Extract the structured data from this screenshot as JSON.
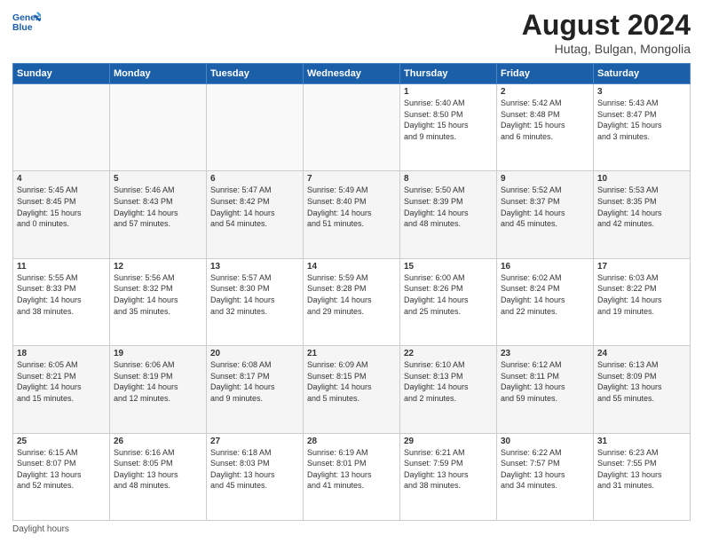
{
  "logo": {
    "text_general": "General",
    "text_blue": "Blue"
  },
  "header": {
    "month_year": "August 2024",
    "location": "Hutag, Bulgan, Mongolia"
  },
  "days_of_week": [
    "Sunday",
    "Monday",
    "Tuesday",
    "Wednesday",
    "Thursday",
    "Friday",
    "Saturday"
  ],
  "footer": {
    "daylight_label": "Daylight hours"
  },
  "weeks": [
    {
      "days": [
        {
          "num": "",
          "info": "",
          "empty": true
        },
        {
          "num": "",
          "info": "",
          "empty": true
        },
        {
          "num": "",
          "info": "",
          "empty": true
        },
        {
          "num": "",
          "info": "",
          "empty": true
        },
        {
          "num": "1",
          "info": "Sunrise: 5:40 AM\nSunset: 8:50 PM\nDaylight: 15 hours\nand 9 minutes."
        },
        {
          "num": "2",
          "info": "Sunrise: 5:42 AM\nSunset: 8:48 PM\nDaylight: 15 hours\nand 6 minutes."
        },
        {
          "num": "3",
          "info": "Sunrise: 5:43 AM\nSunset: 8:47 PM\nDaylight: 15 hours\nand 3 minutes."
        }
      ]
    },
    {
      "days": [
        {
          "num": "4",
          "info": "Sunrise: 5:45 AM\nSunset: 8:45 PM\nDaylight: 15 hours\nand 0 minutes."
        },
        {
          "num": "5",
          "info": "Sunrise: 5:46 AM\nSunset: 8:43 PM\nDaylight: 14 hours\nand 57 minutes."
        },
        {
          "num": "6",
          "info": "Sunrise: 5:47 AM\nSunset: 8:42 PM\nDaylight: 14 hours\nand 54 minutes."
        },
        {
          "num": "7",
          "info": "Sunrise: 5:49 AM\nSunset: 8:40 PM\nDaylight: 14 hours\nand 51 minutes."
        },
        {
          "num": "8",
          "info": "Sunrise: 5:50 AM\nSunset: 8:39 PM\nDaylight: 14 hours\nand 48 minutes."
        },
        {
          "num": "9",
          "info": "Sunrise: 5:52 AM\nSunset: 8:37 PM\nDaylight: 14 hours\nand 45 minutes."
        },
        {
          "num": "10",
          "info": "Sunrise: 5:53 AM\nSunset: 8:35 PM\nDaylight: 14 hours\nand 42 minutes."
        }
      ]
    },
    {
      "days": [
        {
          "num": "11",
          "info": "Sunrise: 5:55 AM\nSunset: 8:33 PM\nDaylight: 14 hours\nand 38 minutes."
        },
        {
          "num": "12",
          "info": "Sunrise: 5:56 AM\nSunset: 8:32 PM\nDaylight: 14 hours\nand 35 minutes."
        },
        {
          "num": "13",
          "info": "Sunrise: 5:57 AM\nSunset: 8:30 PM\nDaylight: 14 hours\nand 32 minutes."
        },
        {
          "num": "14",
          "info": "Sunrise: 5:59 AM\nSunset: 8:28 PM\nDaylight: 14 hours\nand 29 minutes."
        },
        {
          "num": "15",
          "info": "Sunrise: 6:00 AM\nSunset: 8:26 PM\nDaylight: 14 hours\nand 25 minutes."
        },
        {
          "num": "16",
          "info": "Sunrise: 6:02 AM\nSunset: 8:24 PM\nDaylight: 14 hours\nand 22 minutes."
        },
        {
          "num": "17",
          "info": "Sunrise: 6:03 AM\nSunset: 8:22 PM\nDaylight: 14 hours\nand 19 minutes."
        }
      ]
    },
    {
      "days": [
        {
          "num": "18",
          "info": "Sunrise: 6:05 AM\nSunset: 8:21 PM\nDaylight: 14 hours\nand 15 minutes."
        },
        {
          "num": "19",
          "info": "Sunrise: 6:06 AM\nSunset: 8:19 PM\nDaylight: 14 hours\nand 12 minutes."
        },
        {
          "num": "20",
          "info": "Sunrise: 6:08 AM\nSunset: 8:17 PM\nDaylight: 14 hours\nand 9 minutes."
        },
        {
          "num": "21",
          "info": "Sunrise: 6:09 AM\nSunset: 8:15 PM\nDaylight: 14 hours\nand 5 minutes."
        },
        {
          "num": "22",
          "info": "Sunrise: 6:10 AM\nSunset: 8:13 PM\nDaylight: 14 hours\nand 2 minutes."
        },
        {
          "num": "23",
          "info": "Sunrise: 6:12 AM\nSunset: 8:11 PM\nDaylight: 13 hours\nand 59 minutes."
        },
        {
          "num": "24",
          "info": "Sunrise: 6:13 AM\nSunset: 8:09 PM\nDaylight: 13 hours\nand 55 minutes."
        }
      ]
    },
    {
      "days": [
        {
          "num": "25",
          "info": "Sunrise: 6:15 AM\nSunset: 8:07 PM\nDaylight: 13 hours\nand 52 minutes."
        },
        {
          "num": "26",
          "info": "Sunrise: 6:16 AM\nSunset: 8:05 PM\nDaylight: 13 hours\nand 48 minutes."
        },
        {
          "num": "27",
          "info": "Sunrise: 6:18 AM\nSunset: 8:03 PM\nDaylight: 13 hours\nand 45 minutes."
        },
        {
          "num": "28",
          "info": "Sunrise: 6:19 AM\nSunset: 8:01 PM\nDaylight: 13 hours\nand 41 minutes."
        },
        {
          "num": "29",
          "info": "Sunrise: 6:21 AM\nSunset: 7:59 PM\nDaylight: 13 hours\nand 38 minutes."
        },
        {
          "num": "30",
          "info": "Sunrise: 6:22 AM\nSunset: 7:57 PM\nDaylight: 13 hours\nand 34 minutes."
        },
        {
          "num": "31",
          "info": "Sunrise: 6:23 AM\nSunset: 7:55 PM\nDaylight: 13 hours\nand 31 minutes."
        }
      ]
    }
  ]
}
